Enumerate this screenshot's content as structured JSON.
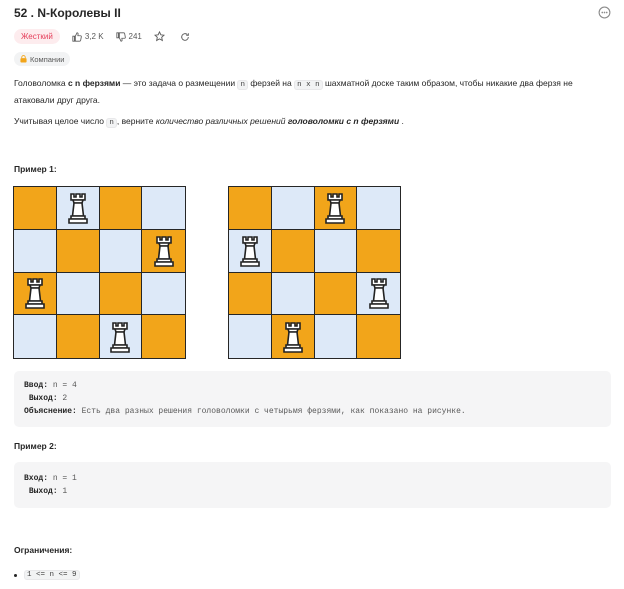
{
  "problem": {
    "title": "52 . N-Королевы II",
    "difficulty": "Жесткий",
    "likes": "3,2 K",
    "dislikes": "241",
    "companies_label": "Компании"
  },
  "description": {
    "p1_a": "Головоломка ",
    "p1_b": "с n ферзями",
    "p1_c": " — это задача о размещении ",
    "p1_code1": "n",
    "p1_d": " ферзей на ",
    "p1_code2": "n x n",
    "p1_e": " шахматной доске таким образом, чтобы никакие два ферзя не атаковали друг друга.",
    "p2_a": "Учитывая целое число ",
    "p2_code": "n",
    "p2_b": ", верните ",
    "p2_c": "количество различных решений",
    "p2_d": " головоломки с n ферзями",
    "p2_e": " ."
  },
  "example1": {
    "heading": "Пример 1:",
    "input_label": "Ввод:",
    "input_value": " n = 4",
    "output_label": "Выход:",
    "output_value": " 2",
    "explanation_label": "Объяснение:",
    "explanation_value": " Есть два разных решения головоломки с четырьмя ферзями, как показано на рисунке."
  },
  "boards": [
    {
      "queens": [
        [
          0,
          1
        ],
        [
          1,
          3
        ],
        [
          2,
          0
        ],
        [
          3,
          2
        ]
      ]
    },
    {
      "queens": [
        [
          0,
          2
        ],
        [
          1,
          0
        ],
        [
          2,
          3
        ],
        [
          3,
          1
        ]
      ]
    }
  ],
  "example2": {
    "heading": "Пример 2:",
    "input_label": "Вход:",
    "input_value": " n = 1",
    "output_label": "Выход:",
    "output_value": " 1"
  },
  "constraints": {
    "heading": "Ограничения:",
    "items": [
      "1 <= n <= 9"
    ]
  },
  "colors": {
    "board_orange": "#f2a51a",
    "board_blue": "#dde9f8",
    "hard_badge_bg": "#fdecee",
    "hard_badge_text": "#e53e5a"
  },
  "icons": [
    "thumbs-up-icon",
    "thumbs-down-icon",
    "star-icon",
    "share-icon",
    "lock-icon",
    "info-icon",
    "queen-icon"
  ]
}
